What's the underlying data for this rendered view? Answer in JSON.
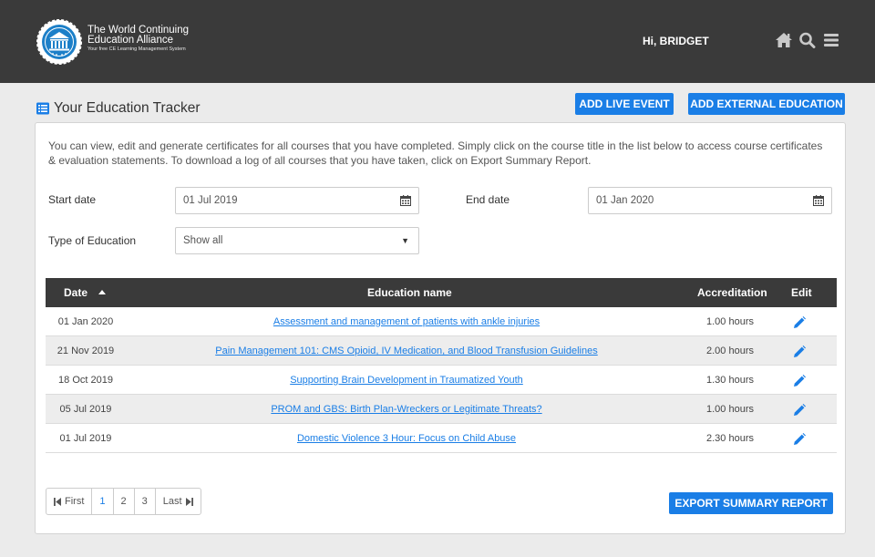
{
  "header": {
    "logo": {
      "line1": "The World Continuing",
      "line2": "Education Alliance",
      "tagline": "Your free CE Learning Management System"
    },
    "greeting_prefix": "Hi, ",
    "user_name": "BRIDGET",
    "icons": [
      "home-icon",
      "search-icon",
      "menu-icon"
    ]
  },
  "page": {
    "title": "Your Education Tracker",
    "title_icon": "list-icon",
    "add_live_label": "ADD LIVE EVENT",
    "add_external_label": "ADD EXTERNAL EDUCATION",
    "intro": "You can view, edit and generate certificates for all courses that you have completed. Simply click on the course title in the list below to access course certificates & evaluation statements. To download a log of all courses that you have taken, click on Export Summary Report."
  },
  "filters": {
    "start_label": "Start date",
    "start_value": "01 Jul 2019",
    "end_label": "End date",
    "end_value": "01 Jan 2020",
    "type_label": "Type of Education",
    "type_value": "Show all"
  },
  "table": {
    "headers": {
      "date": "Date",
      "name": "Education name",
      "accreditation": "Accreditation",
      "edit": "Edit"
    },
    "rows": [
      {
        "date": "01 Jan 2020",
        "name": "Assessment and management of patients with ankle injuries",
        "accreditation": "1.00 hours"
      },
      {
        "date": "21 Nov 2019",
        "name": "Pain Management 101: CMS Opioid, IV Medication, and Blood Transfusion Guidelines",
        "accreditation": "2.00 hours"
      },
      {
        "date": "18 Oct 2019",
        "name": "Supporting Brain Development in Traumatized Youth",
        "accreditation": "1.30 hours"
      },
      {
        "date": "05 Jul 2019",
        "name": "PROM and GBS: Birth Plan-Wreckers or Legitimate Threats?",
        "accreditation": "1.00 hours"
      },
      {
        "date": "01 Jul 2019",
        "name": "Domestic Violence 3 Hour: Focus on Child Abuse",
        "accreditation": "2.30 hours"
      }
    ]
  },
  "pagination": {
    "first": "First",
    "pages": [
      "1",
      "2",
      "3"
    ],
    "active_page": "1",
    "last": "Last"
  },
  "export_label": "EXPORT SUMMARY REPORT",
  "colors": {
    "accent": "#1a7ee6",
    "header_bg": "#3a3a3a"
  }
}
